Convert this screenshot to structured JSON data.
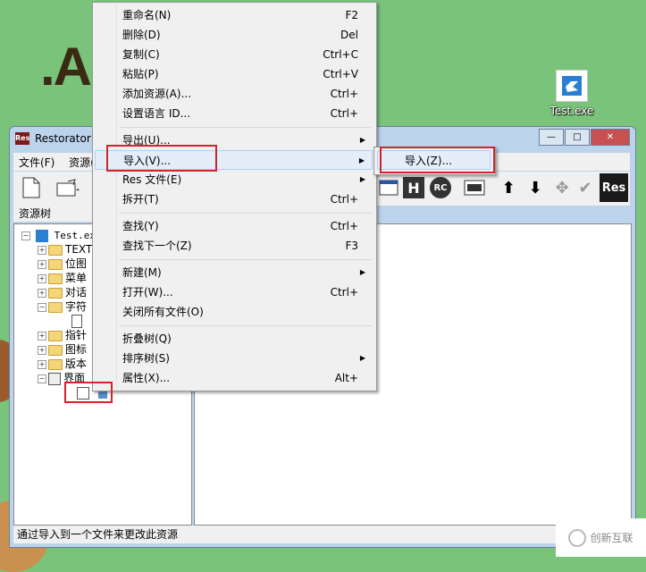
{
  "desktop": {
    "bg_text": ".A",
    "icon_label": "Test.exe"
  },
  "window": {
    "app_icon": "Res",
    "title": "Restorator",
    "minimize": "—",
    "maximize": "□",
    "close": "✕"
  },
  "menubar": {
    "items": [
      "文件(F)",
      "资源("
    ]
  },
  "toolbar": {
    "h_label": "H",
    "rc_label": "RC",
    "res_logo": "Res"
  },
  "tree": {
    "header": "资源树",
    "root": "Test.exe",
    "items": [
      {
        "label": "TEXT"
      },
      {
        "label": "位图"
      },
      {
        "label": "菜单"
      },
      {
        "label": "对话"
      },
      {
        "label": "字符"
      },
      {
        "label": "指针"
      },
      {
        "label": "图标"
      },
      {
        "label": "版本"
      },
      {
        "label": "界面"
      }
    ]
  },
  "status": {
    "text": "通过导入到一个文件来更改此资源"
  },
  "context_menu": {
    "items": [
      {
        "label": "重命名(N)",
        "shortcut": "F2"
      },
      {
        "label": "删除(D)",
        "shortcut": "Del"
      },
      {
        "label": "复制(C)",
        "shortcut": "Ctrl+C"
      },
      {
        "label": "粘贴(P)",
        "shortcut": "Ctrl+V"
      },
      {
        "label": "添加资源(A)...",
        "shortcut": "Ctrl+"
      },
      {
        "label": "设置语言 ID...",
        "shortcut": "Ctrl+"
      },
      {
        "label": "导出(U)..."
      },
      {
        "label": "导入(V)..."
      },
      {
        "label": "Res 文件(E)"
      },
      {
        "label": "拆开(T)",
        "shortcut": "Ctrl+"
      },
      {
        "label": "查找(Y)",
        "shortcut": "Ctrl+"
      },
      {
        "label": "查找下一个(Z)",
        "shortcut": "F3"
      },
      {
        "label": "新建(M)"
      },
      {
        "label": "打开(W)...",
        "shortcut": "Ctrl+"
      },
      {
        "label": "关闭所有文件(O)"
      },
      {
        "label": "折叠树(Q)"
      },
      {
        "label": "排序树(S)"
      },
      {
        "label": "属性(X)...",
        "shortcut": "Alt+"
      }
    ],
    "arrow": "▶"
  },
  "submenu": {
    "item": "导入(Z)..."
  },
  "watermark": "创新互联",
  "colors": {
    "highlight": "#d0262b",
    "desktop": "#79c47a"
  }
}
